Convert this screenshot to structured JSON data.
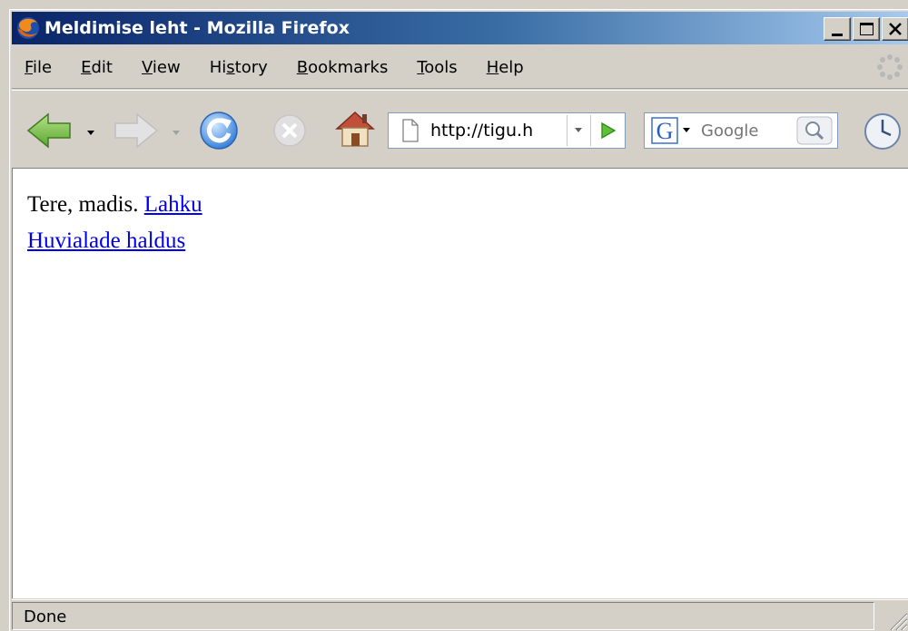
{
  "window": {
    "title": "Meldimise leht - Mozilla Firefox",
    "title_gradient": [
      "#0a246a",
      "#a6caf0"
    ]
  },
  "menu": {
    "items": [
      {
        "label": "File",
        "accel": "F"
      },
      {
        "label": "Edit",
        "accel": "E"
      },
      {
        "label": "View",
        "accel": "V"
      },
      {
        "label": "History",
        "accel": "s"
      },
      {
        "label": "Bookmarks",
        "accel": "B"
      },
      {
        "label": "Tools",
        "accel": "T"
      },
      {
        "label": "Help",
        "accel": "H"
      }
    ]
  },
  "toolbar": {
    "back_icon": "back-arrow-icon",
    "forward_icon": "forward-arrow-icon",
    "reload_icon": "reload-icon",
    "stop_icon": "stop-icon",
    "home_icon": "home-icon",
    "history_icon": "clock-icon"
  },
  "urlbar": {
    "value": "http://tigu.h",
    "page_icon": "page-icon",
    "go_icon": "go-arrow-icon"
  },
  "search": {
    "engine_icon": "google-g-icon",
    "placeholder": "Google",
    "button_icon": "magnifier-icon"
  },
  "content": {
    "greeting": "Tere, madis.",
    "logout_link": "Lahku",
    "manage_link": "Huvialade haldus",
    "link_color": "#0000ee"
  },
  "status": {
    "text": "Done"
  }
}
